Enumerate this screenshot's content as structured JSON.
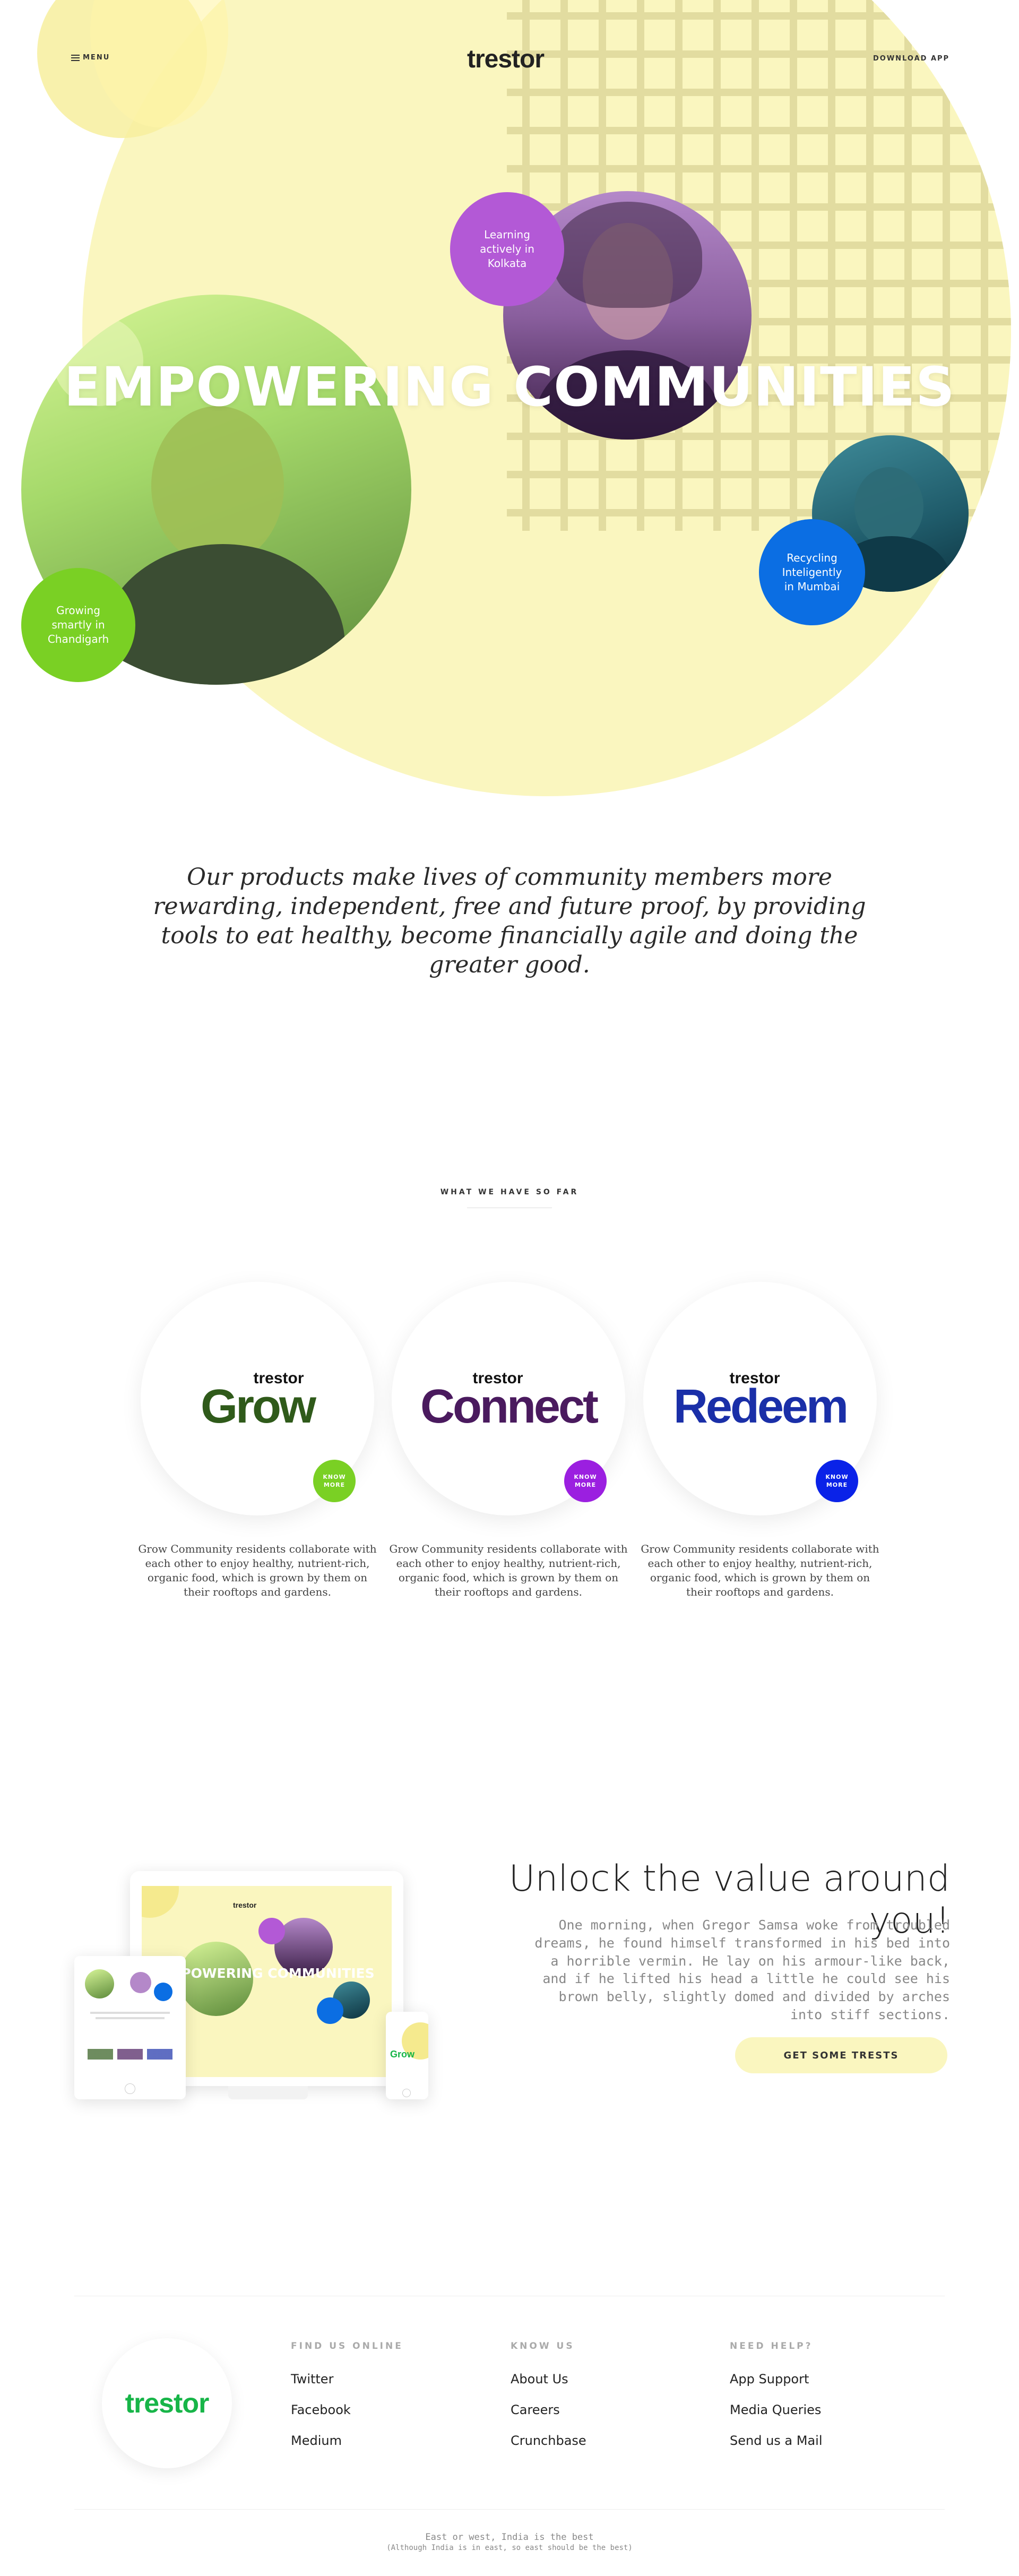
{
  "header": {
    "menu_label": "MENU",
    "logo": "trestor",
    "download_label": "DOWNLOAD APP"
  },
  "hero": {
    "title": "EMPOWERING COMMUNITIES",
    "bubbles": [
      {
        "text": "Learning actively in Kolkata",
        "color": "#b359d6"
      },
      {
        "text": "Growing smartly in Chandigarh",
        "color": "#7ad024"
      },
      {
        "text": "Recycling Inteligently in Mumbai",
        "color": "#0b6ee3"
      }
    ],
    "background_color": "#faf6bf"
  },
  "mission": {
    "text": "Our products make lives of community members more rewarding, independent, free and future proof, by providing tools to eat healthy, become financially agile and doing the greater good."
  },
  "products": {
    "section_label": "WHAT WE HAVE SO FAR",
    "items": [
      {
        "brand": "trestor",
        "name": "Grow",
        "color": "#2f5a1a",
        "button_color": "#7ad024",
        "button_label": "KNOW MORE",
        "description": "Grow Community residents collaborate with each other to enjoy healthy, nutrient-rich, organic food, which is grown by them on their rooftops and gardens."
      },
      {
        "brand": "trestor",
        "name": "Connect",
        "color": "#4a1a5e",
        "button_color": "#9b1fe0",
        "button_label": "KNOW MORE",
        "description": "Grow Community residents collaborate with each other to enjoy healthy, nutrient-rich, organic food, which is grown by them on their rooftops and gardens."
      },
      {
        "brand": "trestor",
        "name": "Redeem",
        "color": "#1a2fa8",
        "button_color": "#0a22e8",
        "button_label": "KNOW MORE",
        "description": "Grow Community residents collaborate with each other to enjoy healthy, nutrient-rich, organic food, which is grown by them on their rooftops and gardens."
      }
    ]
  },
  "unlock": {
    "title": "Unlock the value around you!",
    "body": "One morning, when Gregor Samsa woke from troubled dreams, he found himself transformed in his bed into a horrible vermin. He lay on his armour-like back, and if he lifted his head a little he could see his brown belly, slightly domed and divided by arches into stiff sections.",
    "cta_label": "GET SOME TRESTS",
    "mockup_title": "EMPOWERING COMMUNITIES",
    "mockup_logo": "trestor"
  },
  "footer": {
    "logo": "trestor",
    "logo_color": "#17b548",
    "columns": [
      {
        "heading": "FIND US ONLINE",
        "links": [
          "Twitter",
          "Facebook",
          "Medium"
        ]
      },
      {
        "heading": "KNOW US",
        "links": [
          "About Us",
          "Careers",
          "Crunchbase"
        ]
      },
      {
        "heading": "NEED HELP?",
        "links": [
          "App Support",
          "Media Queries",
          "Send us a Mail"
        ]
      }
    ],
    "copyright_line1": "East or west, India is the best",
    "copyright_line2": "(Although India is in east, so east should be the best)"
  }
}
